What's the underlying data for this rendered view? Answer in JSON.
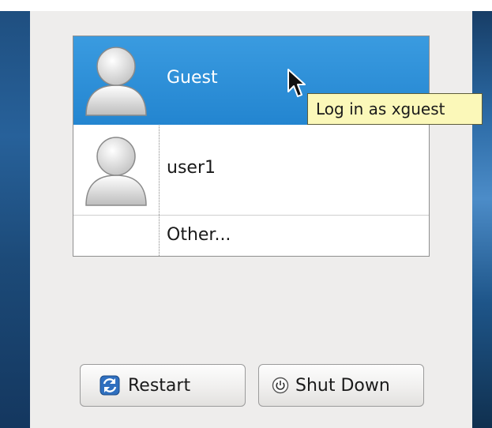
{
  "users": [
    {
      "name": "Guest",
      "selected": true
    },
    {
      "name": "user1",
      "selected": false
    },
    {
      "name": "Other...",
      "selected": false
    }
  ],
  "tooltip": {
    "text": "Log in as xguest"
  },
  "buttons": {
    "restart": {
      "label": "Restart",
      "icon": "restart-icon"
    },
    "shutdown": {
      "label": "Shut Down",
      "icon": "power-icon"
    }
  },
  "colors": {
    "selection": "#2e8fd7",
    "panel": "#eeedec",
    "tooltip_bg": "#fbf8b9",
    "desktop_blue": "#1f4f80"
  }
}
